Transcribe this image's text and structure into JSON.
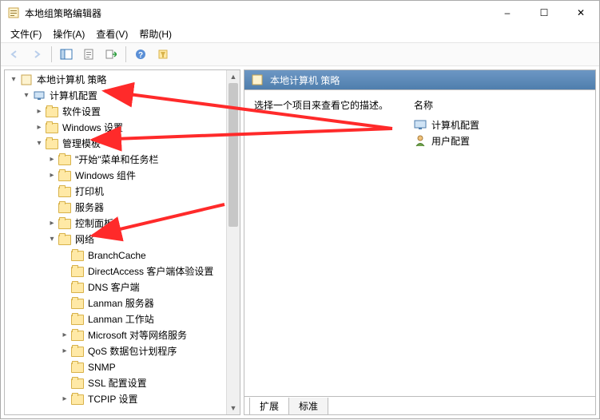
{
  "window": {
    "title": "本地组策略编辑器",
    "controls": {
      "min": "–",
      "max": "☐",
      "close": "✕"
    }
  },
  "menu": {
    "file": "文件(F)",
    "action": "操作(A)",
    "view": "查看(V)",
    "help": "帮助(H)"
  },
  "tree": {
    "root": "本地计算机 策略",
    "computer_config": "计算机配置",
    "software_settings": "软件设置",
    "windows_settings": "Windows 设置",
    "admin_templates": "管理模板",
    "start_menu": "\"开始\"菜单和任务栏",
    "windows_components": "Windows 组件",
    "printers": "打印机",
    "servers": "服务器",
    "control_panel": "控制面板",
    "network": "网络",
    "branchcache": "BranchCache",
    "directaccess": "DirectAccess 客户端体验设置",
    "dns_client": "DNS 客户端",
    "lanman_server": "Lanman 服务器",
    "lanman_workstation": "Lanman 工作站",
    "microsoft_p2p": "Microsoft 对等网络服务",
    "qos": "QoS 数据包计划程序",
    "snmp": "SNMP",
    "ssl_config": "SSL 配置设置",
    "tcpip": "TCPIP 设置"
  },
  "right": {
    "header": "本地计算机 策略",
    "desc": "选择一个项目来查看它的描述。",
    "col_name": "名称",
    "items": {
      "computer_config": "计算机配置",
      "user_config": "用户配置"
    }
  },
  "tabs": {
    "extended": "扩展",
    "standard": "标准"
  },
  "colors": {
    "header_start": "#6d97c4",
    "header_end": "#4f7ead",
    "folder": "#ffe9a6",
    "arrow_annot": "#ff2a2a"
  }
}
